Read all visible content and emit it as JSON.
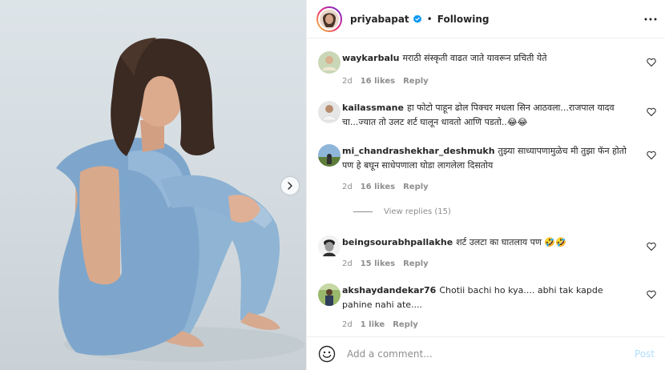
{
  "header": {
    "username": "priyabapat",
    "separator": "•",
    "follow_label": "Following",
    "verified_icon": "verified-badge-icon",
    "more_icon": "more-horizontal-icon"
  },
  "comments": [
    {
      "user": "waykarbalu",
      "text": "मराठी संस्कृती वाढत जाते यावरून प्रचिती येते",
      "time": "2d",
      "likes": "16 likes",
      "reply": "Reply"
    },
    {
      "user": "kailassmane",
      "text": "हा फोटो पाहून ढोल पिक्चर मधला सिन आठवला...राजपाल यादव चा...ज्यात तो उलट शर्ट घालून धावतो आणि पडतो..😂😂",
      "time": "2d",
      "likes": "16 likes",
      "reply": "Reply"
    },
    {
      "user": "mi_chandrashekhar_deshmukh",
      "text": "तुझ्या साध्यापणामुळेच मी तुझा फॅन होतो पण हे बघून साधेपणाला घोडा लागलेला दिसतोय",
      "time": "2d",
      "likes": "16 likes",
      "reply": "Reply",
      "view_replies": "View replies (15)"
    },
    {
      "user": "beingsourabhpallakhe",
      "text": "शर्ट उलटा का घातलाय पण 🤣🤣",
      "time": "2d",
      "likes": "15 likes",
      "reply": "Reply"
    },
    {
      "user": "akshaydandekar76",
      "text": "Chotii bachi ho kya.... abhi tak kapde pahine nahi ate....",
      "time": "2d",
      "likes": "1 like",
      "reply": "Reply"
    }
  ],
  "footer": {
    "placeholder": "Add a comment...",
    "post_label": "Post",
    "emoji_icon": "emoji-smile-icon"
  },
  "colors": {
    "verified": "#0095f6",
    "post_disabled": "#b2dffc",
    "meta_gray": "#8e8e8e",
    "text": "#262626"
  }
}
